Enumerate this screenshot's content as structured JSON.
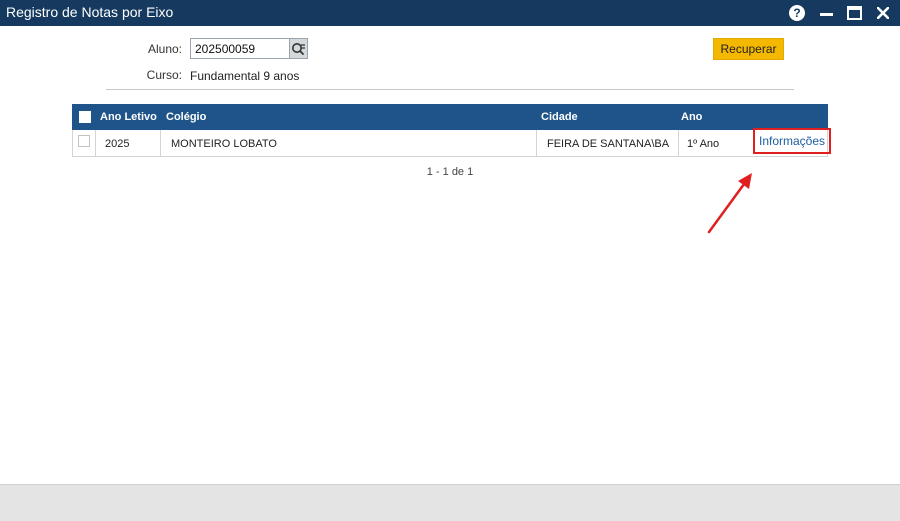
{
  "window": {
    "title": "Registro de Notas por Eixo",
    "controls": [
      "help-icon",
      "minimize-icon",
      "maximize-icon",
      "close-icon"
    ]
  },
  "form": {
    "aluno_label": "Aluno:",
    "aluno_value": "202500059",
    "curso_label": "Curso:",
    "curso_value": "Fundamental 9 anos",
    "recuperar_label": "Recuperar"
  },
  "grid": {
    "columns": [
      "Ano Letivo",
      "Colégio",
      "Cidade",
      "Ano"
    ],
    "rows": [
      {
        "ano_letivo": "2025",
        "colegio": "MONTEIRO LOBATO",
        "cidade": "FEIRA DE SANTANA\\BA",
        "ano": "1º Ano",
        "action": "Informações"
      }
    ]
  },
  "pagination": {
    "text": "1 - 1 de 1"
  },
  "colors": {
    "titlebar": "#163a5f",
    "grid_header": "#1e5489",
    "button": "#f5b800",
    "highlight": "#e02020",
    "link": "#1f5fa0"
  }
}
